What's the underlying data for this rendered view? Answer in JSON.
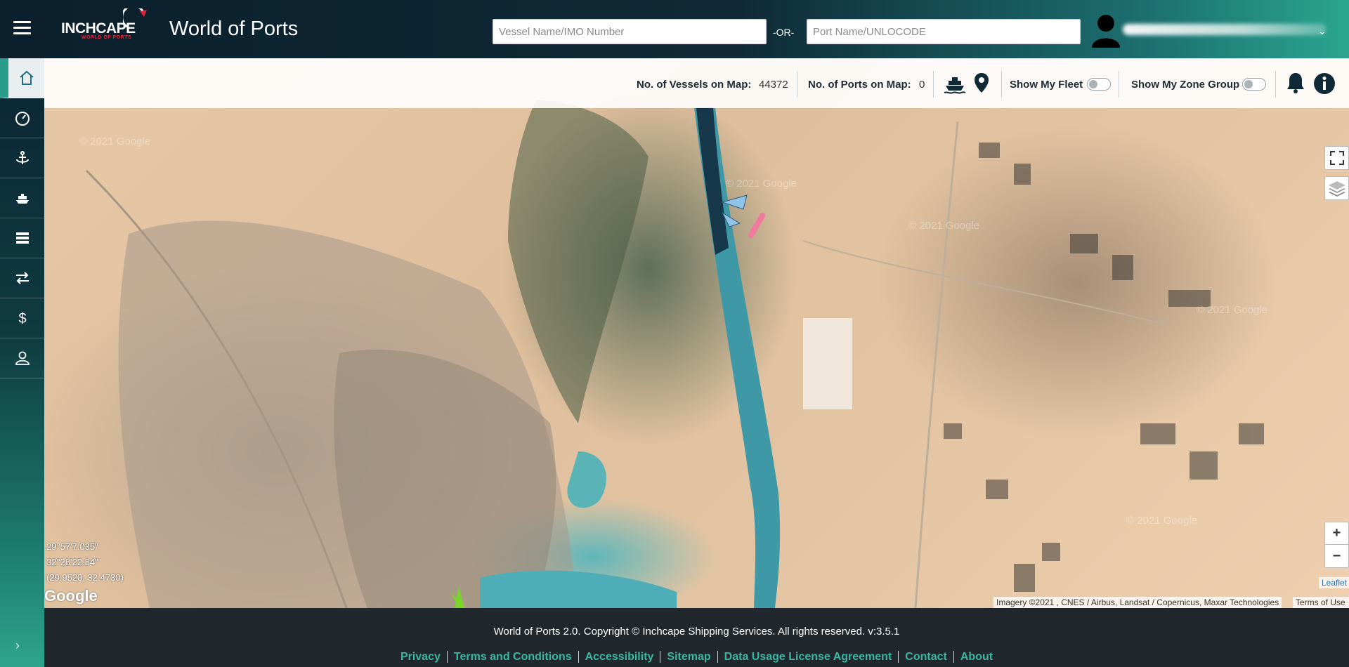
{
  "header": {
    "logo_brand": "INCHCAPE",
    "logo_sub": "WORLD OF PORTS",
    "app_title": "World of Ports",
    "vessel_search_placeholder": "Vessel Name/IMO Number",
    "or_label": "-OR-",
    "port_search_placeholder": "Port Name/UNLOCODE"
  },
  "sidebar": {
    "items": [
      {
        "icon": "home-icon",
        "active": true
      },
      {
        "icon": "dashboard-gauge-icon"
      },
      {
        "icon": "anchor-icon"
      },
      {
        "icon": "ship-icon"
      },
      {
        "icon": "list-icon"
      },
      {
        "icon": "transfer-arrows-icon"
      },
      {
        "icon": "dollar-icon"
      },
      {
        "icon": "user-icon"
      }
    ],
    "expand": "›"
  },
  "toolbar": {
    "vessels_label": "No. of Vessels on Map:",
    "vessels_value": "44372",
    "ports_label": "No. of Ports on Map:",
    "ports_value": "0",
    "fleet_label": "Show My Fleet",
    "zone_label": "Show My Zone Group"
  },
  "map": {
    "coord_dms_lat": "29°57'7.035\"",
    "coord_dms_lon": "32°28'22.84\"",
    "coord_decimal": "(29.9520, 32.4730)",
    "google_logo": "Google",
    "watermark": "© 2021 Google",
    "attribution": "Imagery ©2021 , CNES / Airbus, Landsat / Copernicus, Maxar Technologies",
    "terms": "Terms of Use",
    "leaflet": "Leaflet",
    "zoom_in": "+",
    "zoom_out": "−"
  },
  "footer": {
    "copyright": "World of Ports 2.0. Copyright © Inchcape Shipping Services. All rights reserved. v:3.5.1",
    "links": [
      "Privacy",
      "Terms and Conditions",
      "Accessibility",
      "Sitemap",
      "Data Usage License Agreement",
      "Contact",
      "About"
    ]
  },
  "colors": {
    "accent": "#2a9d8a",
    "footer_link": "#3bb6a0",
    "header_dark": "#0b1f2c",
    "brand_red": "#e0243b"
  }
}
